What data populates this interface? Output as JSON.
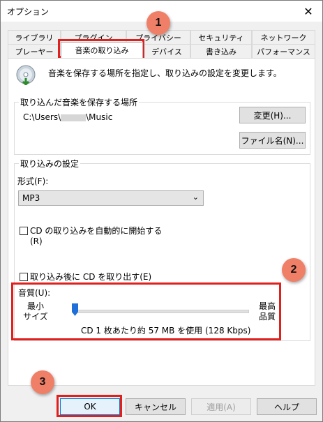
{
  "window": {
    "title": "オプション"
  },
  "tabs": {
    "row1": [
      "ライブラリ",
      "プラグイン",
      "プライバシー",
      "セキュリティ",
      "ネットワーク"
    ],
    "row2": [
      "プレーヤー",
      "音楽の取り込み",
      "デバイス",
      "書き込み",
      "パフォーマンス"
    ]
  },
  "header": {
    "text": "音楽を保存する場所を指定し、取り込みの設定を変更します。"
  },
  "location": {
    "group_title": "取り込んだ音楽を保存する場所",
    "path_prefix": "C:\\Users\\",
    "path_suffix": "\\Music",
    "change_button": "変更(H)...",
    "filename_button": "ファイル名(N)..."
  },
  "rip_settings": {
    "group_title": "取り込みの設定",
    "format_label": "形式(F):",
    "format_value": "MP3",
    "auto_rip_label": "CD の取り込みを自動的に開始する",
    "auto_rip_accel": "(R)",
    "auto_rip_checked": false,
    "eject_label": "取り込み後に CD を取り出す(E)",
    "eject_checked": false,
    "quality_label": "音質(U):",
    "quality_min_line1": "最小",
    "quality_min_line2": "サイズ",
    "quality_max_line1": "最高",
    "quality_max_line2": "品質",
    "quality_level": 0,
    "quality_info": "CD 1 枚あたり約 57 MB を使用 (128 Kbps)"
  },
  "buttons": {
    "ok": "OK",
    "cancel": "キャンセル",
    "apply": "適用(A)",
    "help": "ヘルプ"
  },
  "badges": [
    "1",
    "2",
    "3"
  ],
  "colors": {
    "highlight": "#e0201e",
    "badge": "#f07f68",
    "slider_thumb": "#1e6fd9"
  }
}
